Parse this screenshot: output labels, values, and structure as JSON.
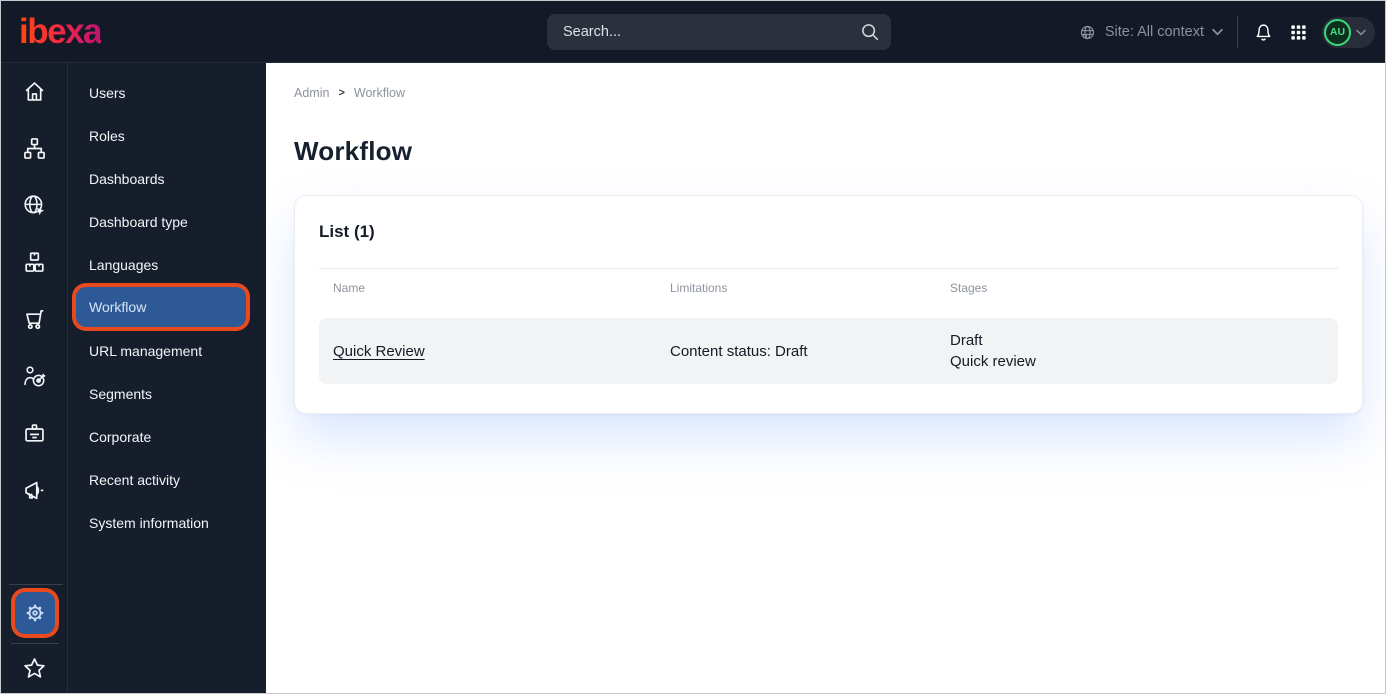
{
  "topbar": {
    "logo": "ibexa",
    "search_placeholder": "Search...",
    "site_context": "Site: All context",
    "avatar_initials": "AU"
  },
  "rail": {
    "icons": [
      "home",
      "content-structure",
      "site-globe",
      "products",
      "commerce-cart",
      "customers-target",
      "corporate-badge",
      "marketing-megaphone",
      "settings-gear",
      "bookmarks-star"
    ]
  },
  "menu": {
    "items": [
      "Users",
      "Roles",
      "Dashboards",
      "Dashboard type",
      "Languages",
      "Workflow",
      "URL management",
      "Segments",
      "Corporate",
      "Recent activity",
      "System information"
    ],
    "selected": "Workflow"
  },
  "breadcrumb": {
    "items": [
      "Admin",
      "Workflow"
    ],
    "separator": ">"
  },
  "page": {
    "title": "Workflow"
  },
  "card": {
    "title": "List (1)",
    "table": {
      "columns": [
        "Name",
        "Limitations",
        "Stages"
      ],
      "rows": [
        {
          "name": "Quick Review",
          "limitations": "Content status: Draft",
          "stages": [
            "Draft",
            "Quick review"
          ]
        }
      ]
    }
  },
  "colors": {
    "topbar_bg": "#131926",
    "sidebar_bg": "#171E2B",
    "selected_blue": "#2D5A96",
    "annotation_highlight": "#E8491D",
    "avatar_green": "#3DD77C",
    "logo_gradient_start": "#FF4713",
    "logo_gradient_end": "#B9176E",
    "row_bg": "#F2F3F5"
  }
}
